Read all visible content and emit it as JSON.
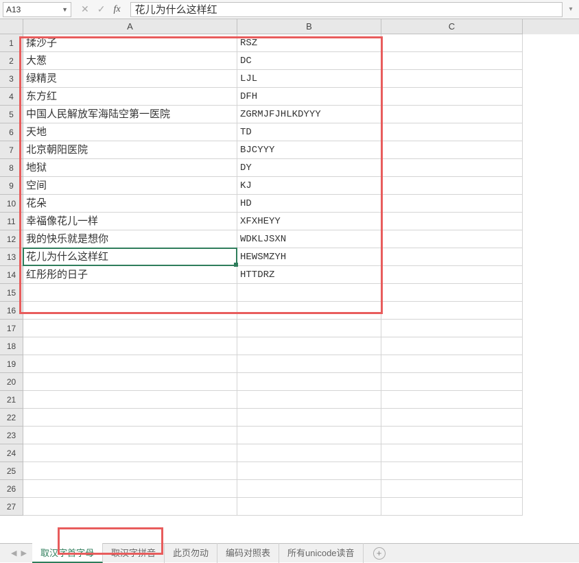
{
  "formula_bar": {
    "name_box": "A13",
    "formula": "花儿为什么这样红"
  },
  "columns": [
    "A",
    "B",
    "C"
  ],
  "active_cell": {
    "row": 13,
    "col": "A"
  },
  "rows": [
    {
      "a": "揉沙子",
      "b": "RSZ"
    },
    {
      "a": "大葱",
      "b": "DC"
    },
    {
      "a": "绿精灵",
      "b": "LJL"
    },
    {
      "a": "东方红",
      "b": "DFH"
    },
    {
      "a": "中国人民解放军海陆空第一医院",
      "b": "ZGRMJFJHLKDYYY"
    },
    {
      "a": "天地",
      "b": "TD"
    },
    {
      "a": "北京朝阳医院",
      "b": "BJCYYY"
    },
    {
      "a": "地狱",
      "b": "DY"
    },
    {
      "a": "空间",
      "b": "KJ"
    },
    {
      "a": "花朵",
      "b": "HD"
    },
    {
      "a": "幸福像花儿一样",
      "b": "XFXHEYY"
    },
    {
      "a": "我的快乐就是想你",
      "b": "WDKLJSXN"
    },
    {
      "a": "花儿为什么这样红",
      "b": "HEWSMZYH"
    },
    {
      "a": "红彤彤的日子",
      "b": "HTTDRZ"
    }
  ],
  "total_visible_rows": 27,
  "tabs": [
    {
      "label": "取汉字首字母",
      "active": true
    },
    {
      "label": "取汉字拼音",
      "active": false
    },
    {
      "label": "此页勿动",
      "active": false
    },
    {
      "label": "编码对照表",
      "active": false
    },
    {
      "label": "所有unicode读音",
      "active": false
    }
  ]
}
